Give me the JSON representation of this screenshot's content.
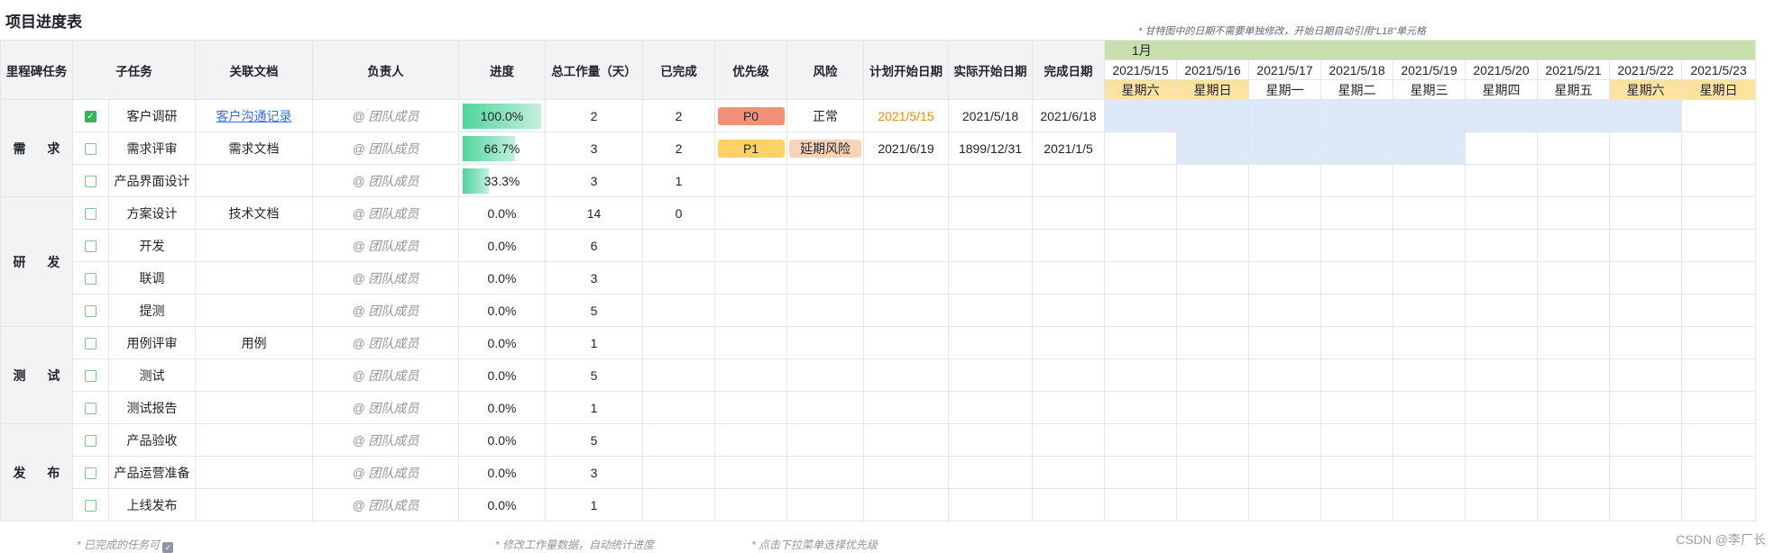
{
  "page": {
    "title": "项目进度表",
    "gantt_note": "* 甘特图中的日期不需要单独修改，开始日期自动引用“L18”单元格",
    "watermark": "CSDN @李厂长"
  },
  "headers": {
    "milestone": "里程碑任务",
    "subtask": "子任务",
    "doc": "关联文档",
    "owner": "负责人",
    "progress": "进度",
    "total": "总工作量（天）",
    "done": "已完成",
    "priority": "优先级",
    "risk": "风险",
    "plan_start": "计划开始日期",
    "actual_start": "实际开始日期",
    "finish": "完成日期"
  },
  "gantt": {
    "month": "1月",
    "dates": [
      "2021/5/15",
      "2021/5/16",
      "2021/5/17",
      "2021/5/18",
      "2021/5/19",
      "2021/5/20",
      "2021/5/21",
      "2021/5/22",
      "2021/5/23"
    ],
    "days": [
      "星期六",
      "星期日",
      "星期一",
      "星期二",
      "星期三",
      "星期四",
      "星期五",
      "星期六",
      "星期日"
    ],
    "bars": [
      {
        "row": 0,
        "from": 0,
        "to": 7
      },
      {
        "row": 1,
        "from": 1,
        "to": 4
      }
    ]
  },
  "milestones": [
    "需 求",
    "研 发",
    "测 试",
    "发 布"
  ],
  "rows": [
    {
      "checked": true,
      "subtask": "客户调研",
      "doc": "客户沟通记录",
      "doc_link": true,
      "owner": "@ 团队成员",
      "progress": 1.0,
      "progress_label": "100.0%",
      "total": "2",
      "done": "2",
      "priority": "P0",
      "risk": "正常",
      "plan_start": "2021/5/15",
      "actual_start": "2021/5/18",
      "finish": "2021/6/18"
    },
    {
      "checked": false,
      "subtask": "需求评审",
      "doc": "需求文档",
      "doc_link": false,
      "owner": "@ 团队成员",
      "progress": 0.667,
      "progress_label": "66.7%",
      "total": "3",
      "done": "2",
      "priority": "P1",
      "risk": "延期风险",
      "plan_start": "2021/6/19",
      "actual_start": "1899/12/31",
      "finish": "2021/1/5"
    },
    {
      "checked": false,
      "subtask": "产品界面设计",
      "doc": "",
      "doc_link": false,
      "owner": "@ 团队成员",
      "progress": 0.333,
      "progress_label": "33.3%",
      "total": "3",
      "done": "1",
      "priority": "",
      "risk": "",
      "plan_start": "",
      "actual_start": "",
      "finish": ""
    },
    {
      "checked": false,
      "subtask": "方案设计",
      "doc": "技术文档",
      "doc_link": false,
      "owner": "@ 团队成员",
      "progress": 0,
      "progress_label": "0.0%",
      "total": "14",
      "done": "0",
      "priority": "",
      "risk": "",
      "plan_start": "",
      "actual_start": "",
      "finish": ""
    },
    {
      "checked": false,
      "subtask": "开发",
      "doc": "",
      "doc_link": false,
      "owner": "@ 团队成员",
      "progress": 0,
      "progress_label": "0.0%",
      "total": "6",
      "done": "",
      "priority": "",
      "risk": "",
      "plan_start": "",
      "actual_start": "",
      "finish": ""
    },
    {
      "checked": false,
      "subtask": "联调",
      "doc": "",
      "doc_link": false,
      "owner": "@ 团队成员",
      "progress": 0,
      "progress_label": "0.0%",
      "total": "3",
      "done": "",
      "priority": "",
      "risk": "",
      "plan_start": "",
      "actual_start": "",
      "finish": ""
    },
    {
      "checked": false,
      "subtask": "提测",
      "doc": "",
      "doc_link": false,
      "owner": "@ 团队成员",
      "progress": 0,
      "progress_label": "0.0%",
      "total": "5",
      "done": "",
      "priority": "",
      "risk": "",
      "plan_start": "",
      "actual_start": "",
      "finish": ""
    },
    {
      "checked": false,
      "subtask": "用例评审",
      "doc": "用例",
      "doc_link": false,
      "owner": "@ 团队成员",
      "progress": 0,
      "progress_label": "0.0%",
      "total": "1",
      "done": "",
      "priority": "",
      "risk": "",
      "plan_start": "",
      "actual_start": "",
      "finish": ""
    },
    {
      "checked": false,
      "subtask": "测试",
      "doc": "",
      "doc_link": false,
      "owner": "@ 团队成员",
      "progress": 0,
      "progress_label": "0.0%",
      "total": "5",
      "done": "",
      "priority": "",
      "risk": "",
      "plan_start": "",
      "actual_start": "",
      "finish": ""
    },
    {
      "checked": false,
      "subtask": "测试报告",
      "doc": "",
      "doc_link": false,
      "owner": "@ 团队成员",
      "progress": 0,
      "progress_label": "0.0%",
      "total": "1",
      "done": "",
      "priority": "",
      "risk": "",
      "plan_start": "",
      "actual_start": "",
      "finish": ""
    },
    {
      "checked": false,
      "subtask": "产品验收",
      "doc": "",
      "doc_link": false,
      "owner": "@ 团队成员",
      "progress": 0,
      "progress_label": "0.0%",
      "total": "5",
      "done": "",
      "priority": "",
      "risk": "",
      "plan_start": "",
      "actual_start": "",
      "finish": ""
    },
    {
      "checked": false,
      "subtask": "产品运营准备",
      "doc": "",
      "doc_link": false,
      "owner": "@ 团队成员",
      "progress": 0,
      "progress_label": "0.0%",
      "total": "3",
      "done": "",
      "priority": "",
      "risk": "",
      "plan_start": "",
      "actual_start": "",
      "finish": ""
    },
    {
      "checked": false,
      "subtask": "上线发布",
      "doc": "",
      "doc_link": false,
      "owner": "@ 团队成员",
      "progress": 0,
      "progress_label": "0.0%",
      "total": "1",
      "done": "",
      "priority": "",
      "risk": "",
      "plan_start": "",
      "actual_start": "",
      "finish": ""
    }
  ],
  "footnotes": {
    "completed": "* 已完成的任务可",
    "workload": "* 修改工作量数据，自动统计进度",
    "priority": "* 点击下拉菜单选择优先级"
  },
  "colors": {
    "progress_fill": "#4fd49e",
    "gantt_bar": "#dde9f8",
    "month_band": "#c7e0ae",
    "weekend": "#fde2a0",
    "p0": "#f2907a",
    "p1": "#fdd264",
    "risk_tag": "#fad3b8",
    "plan_start_highlight": "#ff8800"
  }
}
